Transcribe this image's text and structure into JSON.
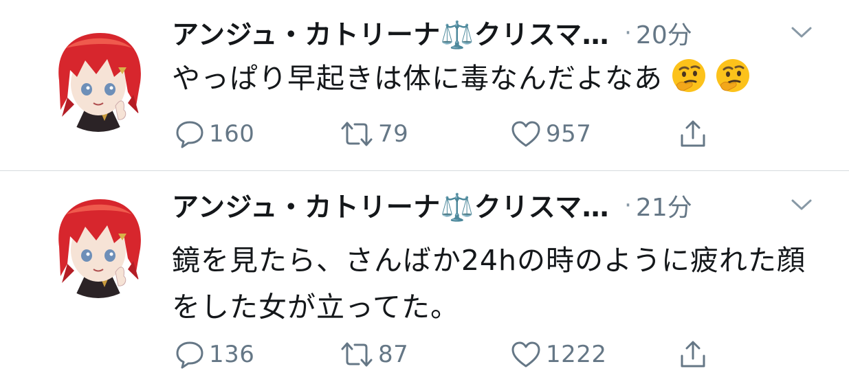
{
  "colors": {
    "text": "#14171a",
    "secondary": "#657786",
    "divider": "#d6dadd",
    "hair": "#d7262d"
  },
  "tweets": [
    {
      "author": "アンジュ・カトリーナ⚖️クリスマ…",
      "separator": "·",
      "time": "20分",
      "text": "やっぱり早起きは体に毒なんだよなあ",
      "emoji": [
        "thinking-face",
        "thinking-face"
      ],
      "reply_count": "160",
      "retweet_count": "79",
      "like_count": "957",
      "icons": [
        "reply-icon",
        "retweet-icon",
        "like-icon",
        "share-icon",
        "chevron-down-icon"
      ]
    },
    {
      "author": "アンジュ・カトリーナ⚖️クリスマ…",
      "separator": "·",
      "time": "21分",
      "text": "鏡を見たら、さんばか24hの時のように疲れた顔をした女が立ってた。",
      "emoji": [],
      "reply_count": "136",
      "retweet_count": "87",
      "like_count": "1222",
      "icons": [
        "reply-icon",
        "retweet-icon",
        "like-icon",
        "share-icon",
        "chevron-down-icon"
      ]
    }
  ]
}
